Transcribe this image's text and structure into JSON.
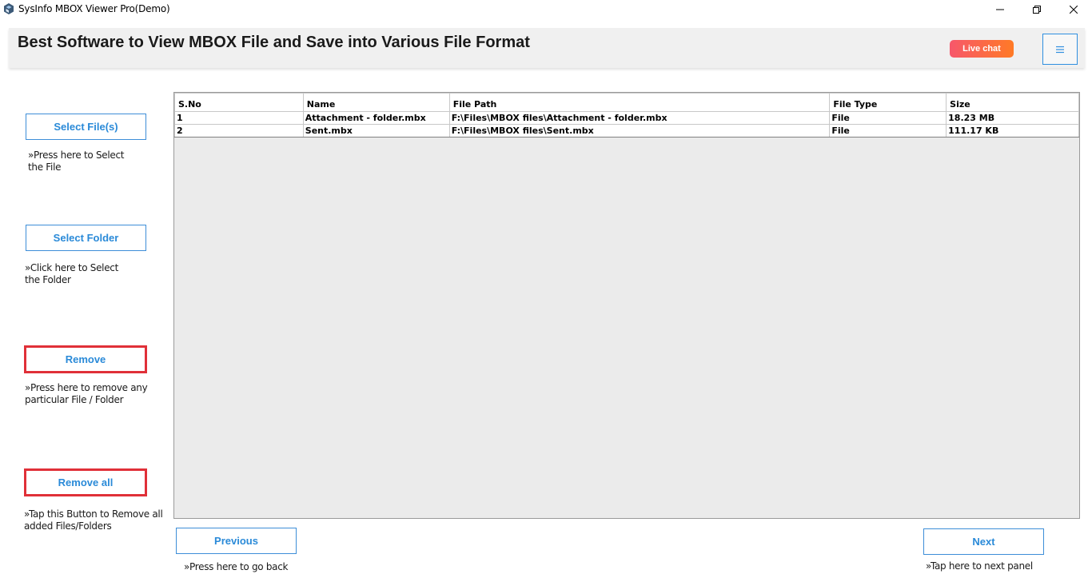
{
  "window": {
    "title": "SysInfo MBOX Viewer Pro(Demo)",
    "controls": [
      "minimize",
      "maximize",
      "close"
    ]
  },
  "header": {
    "title": "Best Software to View MBOX File and Save into Various File Format",
    "live_chat_label": "Live chat",
    "menu_icon": "hamburger-icon",
    "menu_glyph": "≡",
    "accent_color": "#2f8fe0"
  },
  "sidebar": {
    "select_files": {
      "label": "Select File(s)",
      "hint_line1": "»Press here to Select",
      "hint_line2": "the File"
    },
    "select_folder": {
      "label": "Select Folder",
      "hint_line1": "»Click here to Select",
      "hint_line2": "the Folder"
    },
    "remove": {
      "label": "Remove",
      "hint_line1": "»Press here to remove any",
      "hint_line2": "particular File / Folder"
    },
    "remove_all": {
      "label": "Remove all",
      "hint_line1": "»Tap this Button to Remove all",
      "hint_line2": "added Files/Folders"
    }
  },
  "table": {
    "columns": [
      "S.No",
      "Name",
      "File Path",
      "File Type",
      "Size"
    ],
    "rows": [
      [
        "1",
        "Attachment - folder.mbx",
        "F:\\Files\\MBOX files\\Attachment - folder.mbx",
        "File",
        "18.23 MB"
      ],
      [
        "2",
        "Sent.mbx",
        "F:\\Files\\MBOX files\\Sent.mbx",
        "File",
        "111.17 KB"
      ]
    ]
  },
  "footer": {
    "previous_label": "Previous",
    "previous_hint": "»Press here to go back",
    "next_label": "Next",
    "next_hint": "»Tap here to next panel"
  },
  "colors": {
    "button_text": "#2a8ad8",
    "highlight_border": "#e03038",
    "live_chat_gradient": [
      "#f7576b",
      "#ff7a26"
    ]
  }
}
